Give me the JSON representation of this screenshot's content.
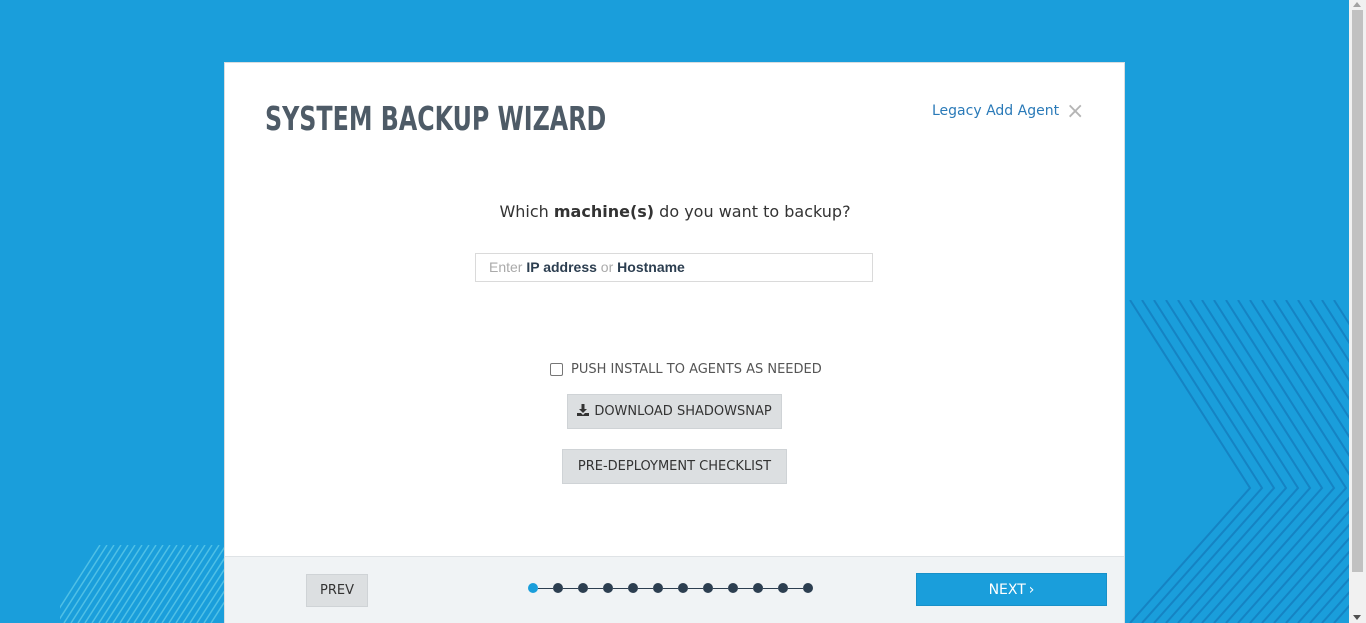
{
  "wizard": {
    "title": "SYSTEM BACKUP WIZARD",
    "legacy_link": "Legacy Add Agent",
    "close_icon": "close-icon"
  },
  "question": {
    "prefix": "Which ",
    "bold": "machine(s)",
    "suffix": " do you want to backup?"
  },
  "host_input": {
    "enter": "Enter ",
    "ip": "IP address",
    "or": " or ",
    "hostname": "Hostname"
  },
  "push_install": {
    "label": "PUSH INSTALL TO AGENTS AS NEEDED",
    "checked": false
  },
  "buttons": {
    "download": "DOWNLOAD SHADOWSNAP",
    "download_icon": "download-icon",
    "checklist": "PRE-DEPLOYMENT CHECKLIST",
    "prev": "PREV",
    "next": "NEXT",
    "next_icon": "chevron-right-icon"
  },
  "steps": {
    "total": 12,
    "current": 1
  },
  "colors": {
    "background": "#1a9edb",
    "accent": "#1a9edb",
    "dark": "#2c3e50",
    "title": "#4e5b67"
  }
}
